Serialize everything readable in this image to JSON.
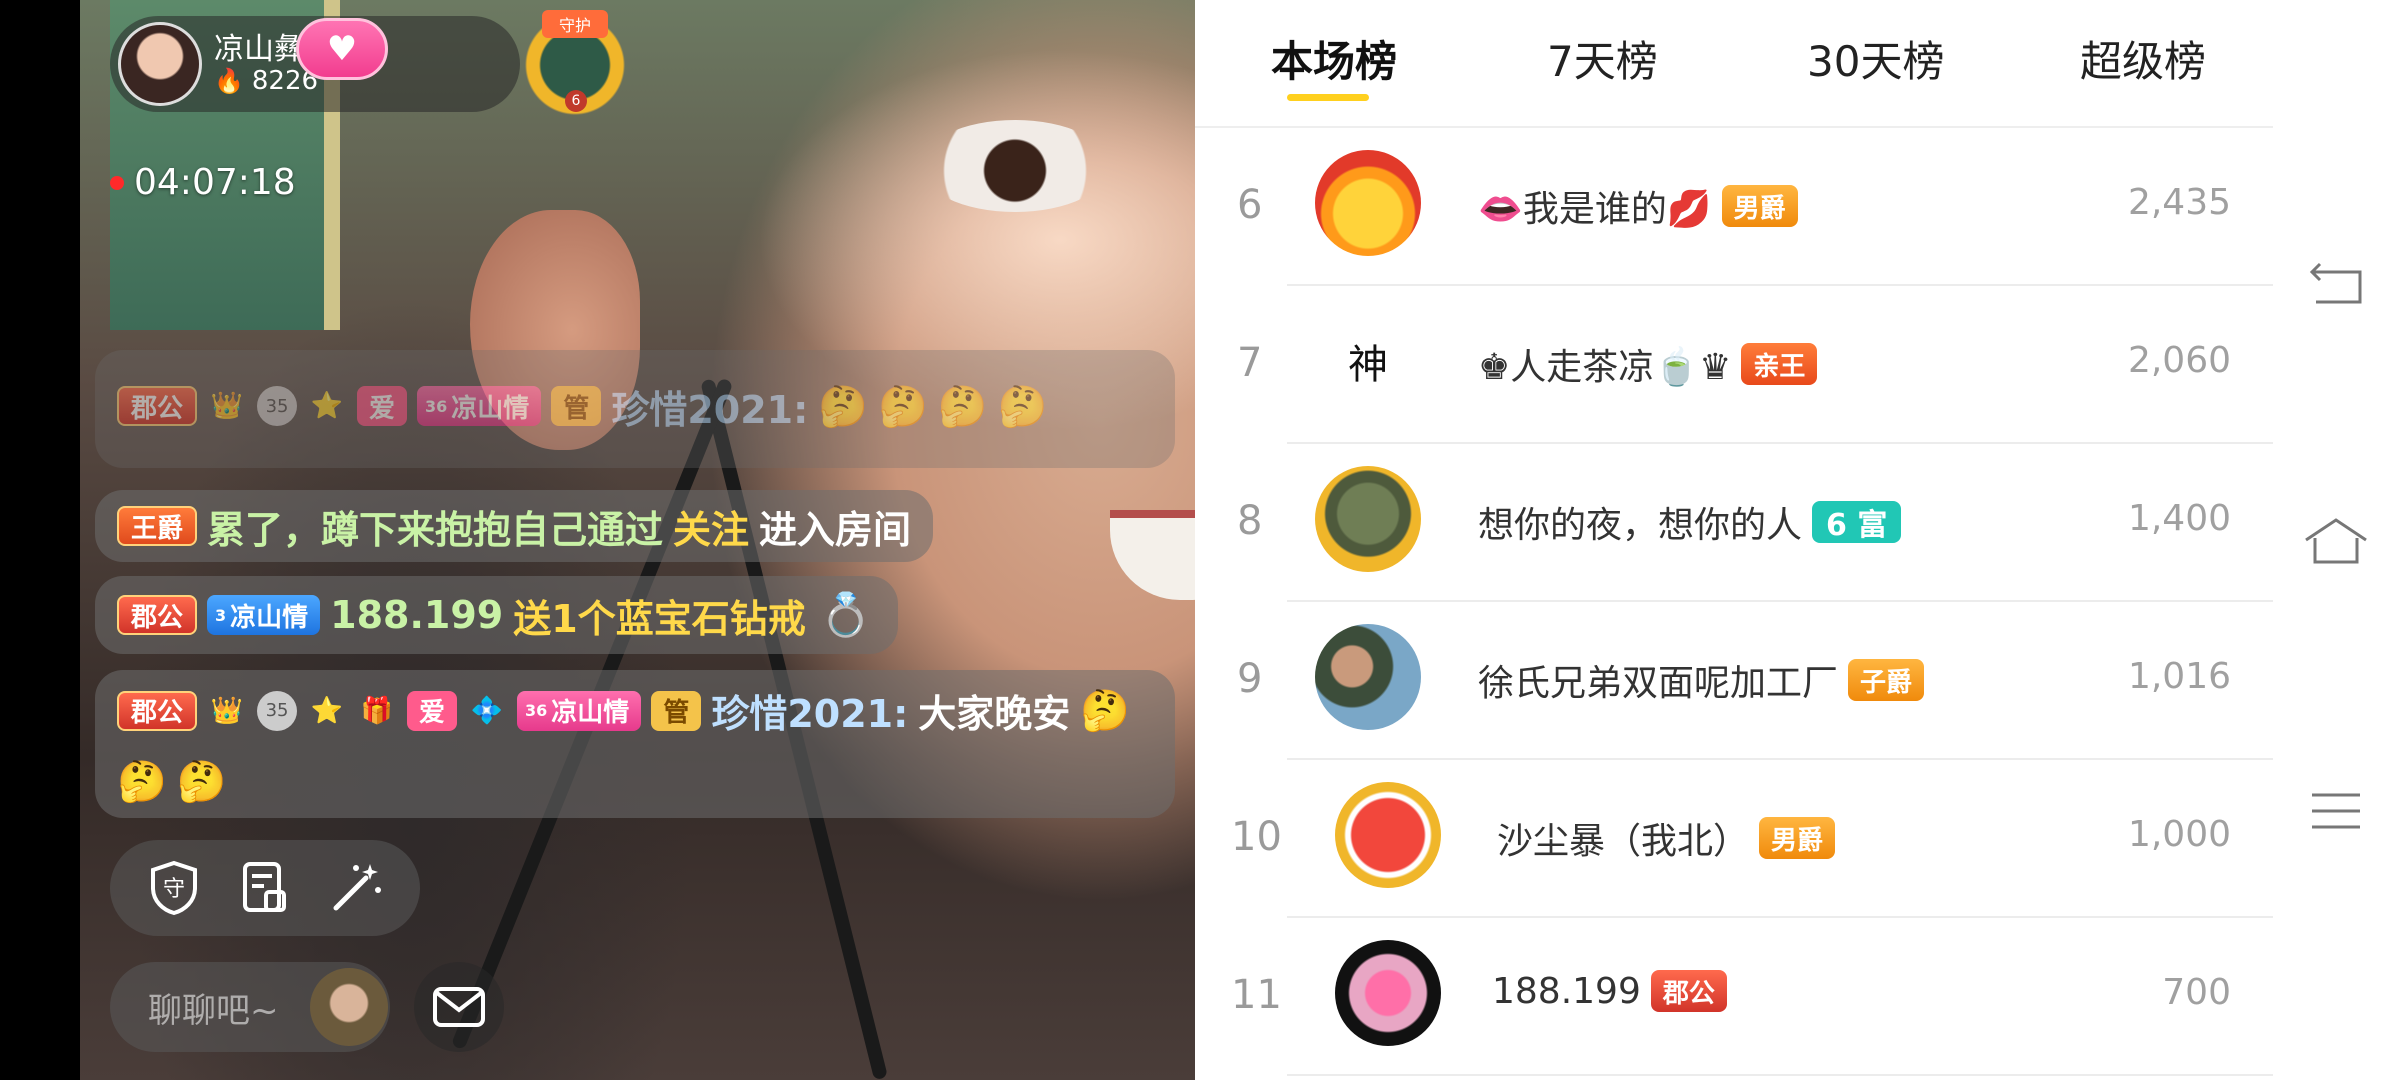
{
  "host": {
    "name": "凉山彝妹…",
    "heat": "8226",
    "guard_label": "守护",
    "guard_level": "6"
  },
  "live": {
    "timer": "04:07:18"
  },
  "chat": {
    "messages": [
      {
        "badges": [
          "郡公",
          "35",
          "爱",
          "36",
          "凉山情",
          "管"
        ],
        "user": "珍惜2021:",
        "text": "",
        "emojis": [
          "🤔",
          "🤔",
          "🤔",
          "🤔"
        ]
      },
      {
        "badges": [
          "王爵"
        ],
        "user": "累了，蹲下来抱抱自己通过",
        "highlight": "关注",
        "text": "进入房间"
      },
      {
        "badges": [
          "郡公",
          "3",
          "凉山情"
        ],
        "user": "188.199",
        "highlight": "送1个蓝宝石钻戒",
        "text": ""
      },
      {
        "badges": [
          "郡公",
          "35",
          "爱",
          "36",
          "凉山情",
          "管"
        ],
        "user": "珍惜2021:",
        "text": "大家晚安",
        "emojis": [
          "🤔",
          "🤔",
          "🤔"
        ]
      }
    ]
  },
  "input": {
    "placeholder": "聊聊吧~"
  },
  "ranking": {
    "tabs": [
      {
        "label": "本场榜",
        "active": true
      },
      {
        "label": "7天榜",
        "active": false
      },
      {
        "label": "30天榜",
        "active": false
      },
      {
        "label": "超级榜",
        "active": false
      }
    ],
    "rows": [
      {
        "rank": "6",
        "name": "👄我是谁的💋",
        "tag": "男爵",
        "tag_type": "nanjue",
        "score": "2,435",
        "avatar": "chick-2021-avatar"
      },
      {
        "rank": "7",
        "name": "♚人走茶凉🍵♛",
        "tag": "亲王",
        "tag_type": "qinwang",
        "score": "2,060",
        "avatar": "calligraphy-avatar",
        "avatar_text": "神"
      },
      {
        "rank": "8",
        "name": "想你的夜，想你的人",
        "tag": "6 富",
        "tag_type": "fu",
        "score": "1,400",
        "avatar": "landscape-avatar"
      },
      {
        "rank": "9",
        "name": "徐氏兄弟双面呢加工厂",
        "tag": "子爵",
        "tag_type": "zijue",
        "score": "1,016",
        "avatar": "photo-avatar"
      },
      {
        "rank": "10",
        "name": "沙尘暴（我北）",
        "tag": "男爵",
        "tag_type": "nanjue",
        "score": "1,000",
        "avatar": "wink-emoji-avatar"
      },
      {
        "rank": "11",
        "name": "188.199",
        "tag": "郡公",
        "tag_type": "junggong",
        "score": "700",
        "avatar": "flower-avatar"
      }
    ]
  },
  "colors": {
    "accent": "#ffd01e",
    "fu_tag": "#21c7b5",
    "highlight": "#ffd94a"
  }
}
